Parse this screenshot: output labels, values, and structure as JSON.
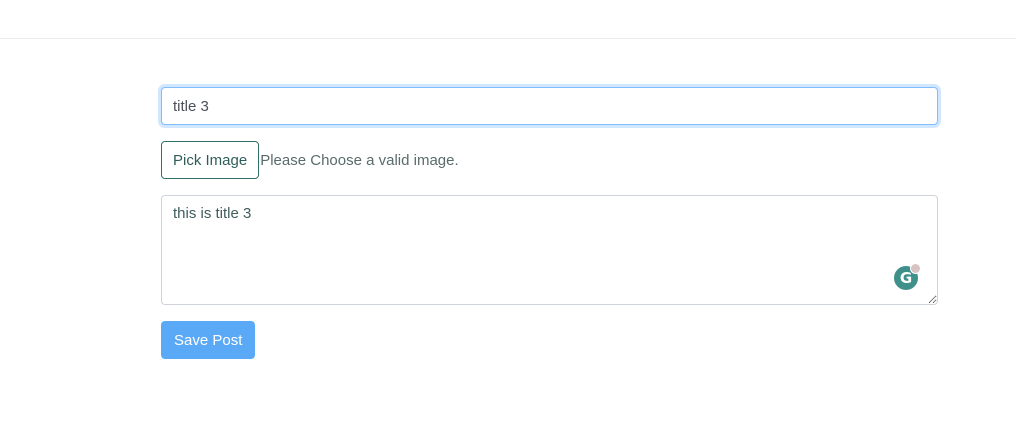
{
  "form": {
    "title_value": "title 3",
    "pick_image_label": "Pick Image",
    "image_hint": "Please Choose a valid image.",
    "description_value": "this is title 3",
    "save_label": "Save Post",
    "grammarly_letter": "G"
  },
  "colors": {
    "focus_border": "#80bdff",
    "save_button_bg": "#5aa9f7",
    "pick_button_border": "#2f6f6a",
    "grammarly_bg": "#3f8f8a"
  },
  "icons": {
    "grammarly": "grammarly-icon"
  }
}
